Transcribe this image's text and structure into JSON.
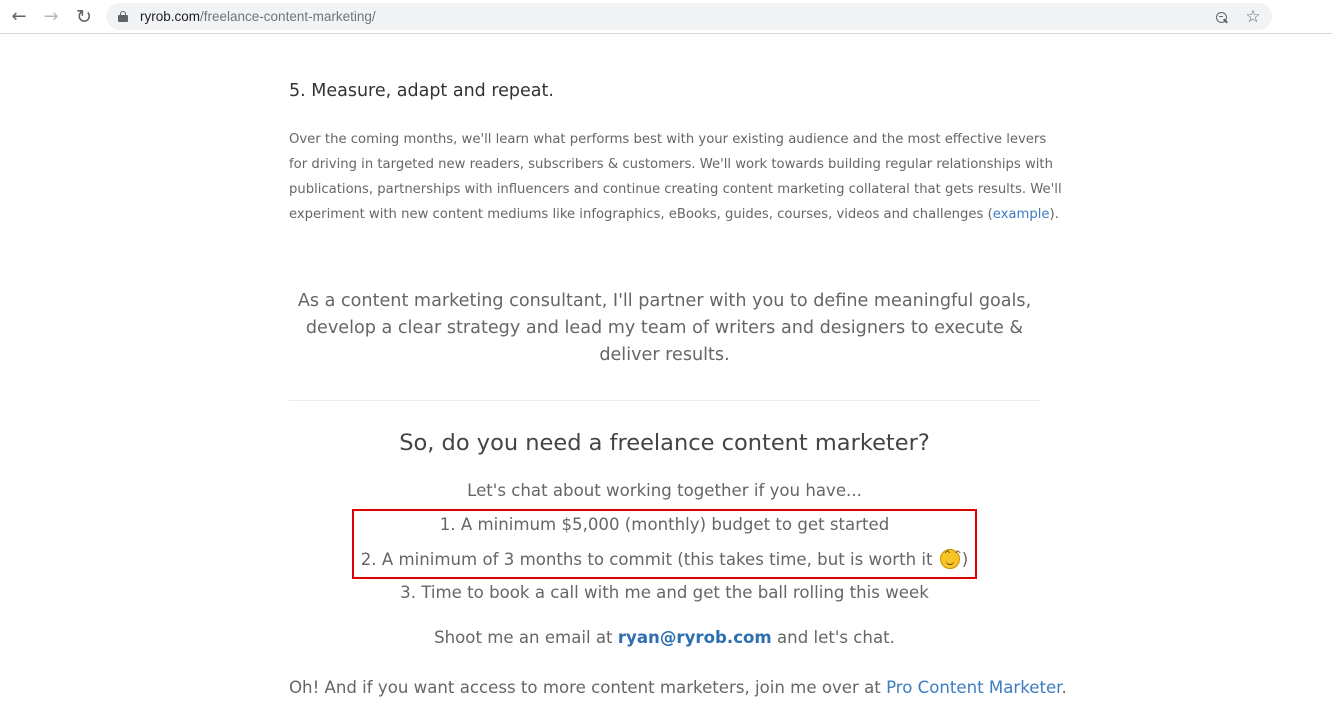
{
  "browser": {
    "url_host": "ryrob.com",
    "url_path": "/freelance-content-marketing/"
  },
  "page": {
    "step_heading": "5. Measure, adapt and repeat.",
    "step_paragraph_lines": [
      "Over the coming months, we'll learn what performs best with your existing audience and the most effective levers",
      "for driving in targeted new readers, subscribers & customers. We'll work towards building regular relationships with",
      "publications, partnerships with influencers and continue creating content marketing collateral that gets results. We'll",
      "experiment with new content mediums like infographics, eBooks, guides, courses, videos and challenges ("
    ],
    "example_link": "example",
    "paragraph_end": ").",
    "quote_lines": [
      "As a content marketing consultant, I'll partner with you to define meaningful goals,",
      "develop a clear strategy and lead my team of writers and designers to execute &",
      "deliver results."
    ],
    "cta_title": "So, do you need a freelance content marketer?",
    "cta_intro": "Let's chat about working together if you have...",
    "requirement_1": "1. A minimum $5,000 (monthly) budget to get started",
    "requirement_2": "2. A minimum of 3 months to commit (this takes time, but is worth it",
    "requirement_2_end": ")",
    "requirement_3": "3. Time to book a call with me and get the ball rolling this week",
    "email_pre": "Shoot me an email at ",
    "email": "ryan@ryrob.com",
    "email_post": " and let's chat.",
    "pro_pre": "Oh! And if you want access to more content marketers, join me over at ",
    "pro_link": "Pro Content Marketer",
    "pro_post": "."
  }
}
